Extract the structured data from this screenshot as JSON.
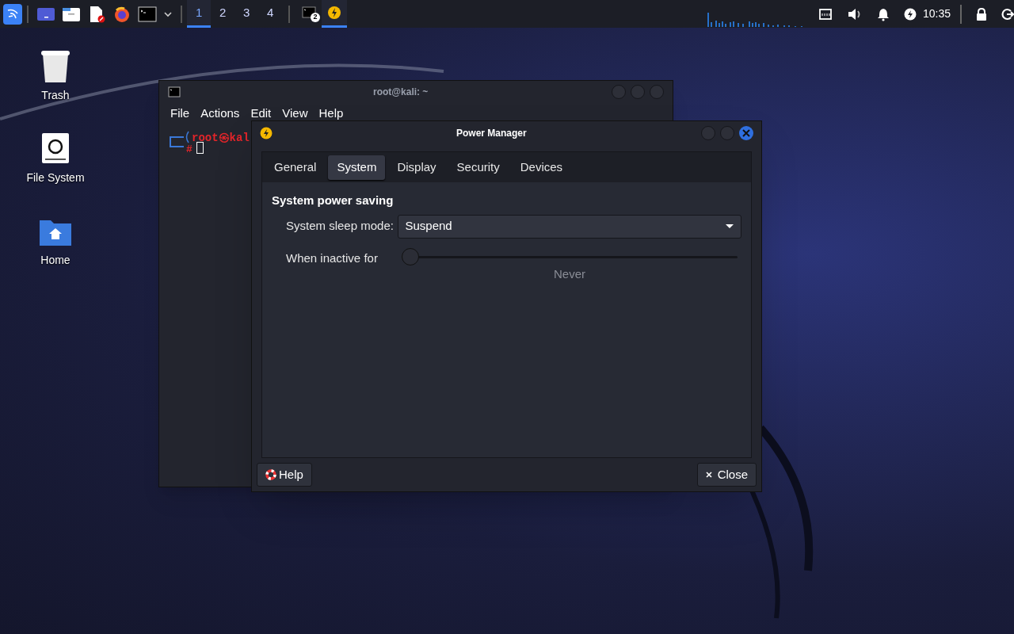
{
  "taskbar": {
    "workspaces": [
      {
        "label": "1",
        "selected": true
      },
      {
        "label": "2",
        "selected": false
      },
      {
        "label": "3",
        "selected": false
      },
      {
        "label": "4",
        "selected": false
      }
    ],
    "tasks": [
      {
        "kind": "terminal",
        "badge": "2",
        "selected": false
      },
      {
        "kind": "power",
        "selected": true
      }
    ],
    "clock": "10:35"
  },
  "desktop_icons": [
    {
      "kind": "trash",
      "label": "Trash"
    },
    {
      "kind": "drive",
      "label": "File System"
    },
    {
      "kind": "home",
      "label": "Home"
    }
  ],
  "terminal": {
    "title": "root@kali: ~",
    "menu": [
      "File",
      "Actions",
      "Edit",
      "View",
      "Help"
    ],
    "prompt_user": "root㉿kal",
    "prompt_symbol": "#"
  },
  "dialog": {
    "title": "Power Manager",
    "tabs": [
      {
        "label": "General",
        "selected": false
      },
      {
        "label": "System",
        "selected": true
      },
      {
        "label": "Display",
        "selected": false
      },
      {
        "label": "Security",
        "selected": false
      },
      {
        "label": "Devices",
        "selected": false
      }
    ],
    "section_title": "System power saving",
    "sleep_mode": {
      "label": "System sleep mode:",
      "value": "Suspend"
    },
    "inactive": {
      "label": "When inactive for",
      "level": 0,
      "reading": "Never"
    },
    "buttons": [
      {
        "kind": "help",
        "label": "Help"
      },
      {
        "kind": "close",
        "label": "Close"
      }
    ]
  }
}
